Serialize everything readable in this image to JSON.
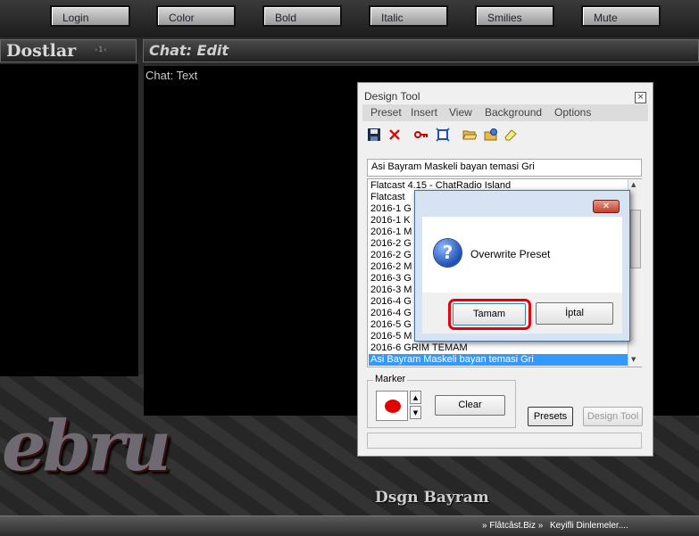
{
  "top_toolbar": {
    "buttons": [
      {
        "label": "Login"
      },
      {
        "label": "Color"
      },
      {
        "label": "Bold"
      },
      {
        "label": "Italic"
      },
      {
        "label": "Smilies"
      },
      {
        "label": "Mute"
      }
    ]
  },
  "friends_panel": {
    "title": "Dostlar",
    "count": "›1‹"
  },
  "chat_panel": {
    "title": "Chat: Edit",
    "text_label": "Chat: Text"
  },
  "decoration": {
    "logo_text": "ebru",
    "signature": "Dsgn Bayram"
  },
  "status_bar": {
    "site": "» Flâtcâst.Biz »",
    "message": "Keyifli Dinlemeler...."
  },
  "design_tool": {
    "title": "Design Tool",
    "close": "×",
    "menu": [
      "Preset",
      "Insert",
      "View",
      "Background",
      "Options"
    ],
    "toolbar_icons": [
      "save-icon",
      "delete-icon",
      "key-icon",
      "fit-icon",
      "open-folder-icon",
      "settings-folder-icon",
      "eraser-icon"
    ],
    "preset_name": "Asi Bayram Maskeli bayan temasi Gri",
    "preset_list": [
      "Flatcast 4.15 - ChatRadio Island",
      "Flatcast",
      "2016-1 G",
      "2016-1 K",
      "2016-1 M",
      "2016-2 G",
      "2016-2 G",
      "2016-2 M",
      "2016-3 G",
      "2016-3 M",
      "2016-4 G",
      "2016-4 G",
      "2016-5 G",
      "2016-5 M",
      "2016-6 GRIM TEMAM",
      "Asi Bayram Maskeli bayan temasi Gri"
    ],
    "selected_index": 15,
    "marker": {
      "legend": "Marker",
      "color": "#e00000",
      "clear_label": "Clear"
    },
    "presets_label": "Presets",
    "design_tool_label": "Design Tool"
  },
  "dialog": {
    "close": "✕",
    "message": "Overwrite Preset",
    "ok_label": "Tamam",
    "cancel_label": "İptal"
  },
  "colors": {
    "highlight": "#e2000f",
    "selection": "#3399ff"
  }
}
